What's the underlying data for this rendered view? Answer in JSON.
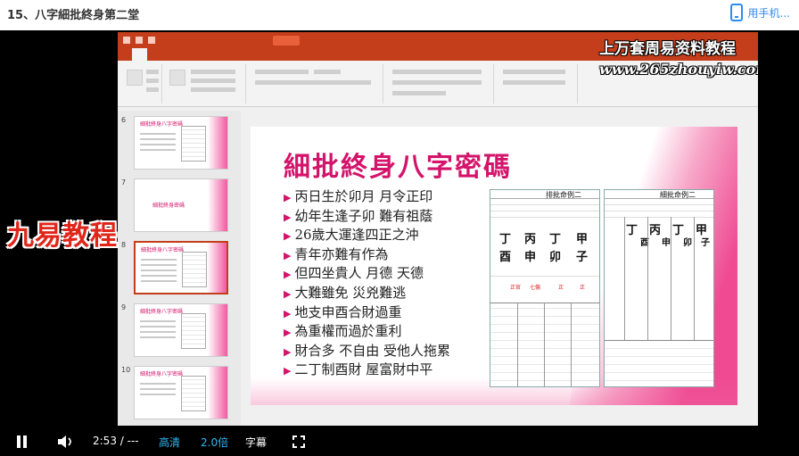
{
  "page": {
    "title": "15、八字細批終身第二堂"
  },
  "header": {
    "phone_label": "用手机..."
  },
  "watermark": {
    "line1": "上万套周易资料教程",
    "line2": "www.265zhouyiw.com"
  },
  "overlay_logo": "九易教程",
  "thumbnails": [
    {
      "num": "6",
      "title": "細批終身八字密碼"
    },
    {
      "num": "7",
      "title": "細批終身密碼"
    },
    {
      "num": "8",
      "title": "細批終身八字密碼"
    },
    {
      "num": "9",
      "title": "細批終身八字密碼"
    },
    {
      "num": "10",
      "title": "細批終身八字密碼"
    }
  ],
  "slide": {
    "title": "細批終身八字密碼",
    "bullets": [
      "丙日生於卯月 月令正印",
      "幼年生逢子卯 難有祖蔭",
      "26歲大運逢四正之沖",
      "青年亦難有作為",
      "但四坐貴人 月德 天德",
      "大難雖免 災兇難逃",
      "地支申酉合財過重",
      "為重權而過於重利",
      "財合多 不自由 受他人拖累",
      "二丁制酉財 屋富財中平"
    ],
    "chart1": {
      "title": "排批命例二",
      "pillars_top": [
        "丁",
        "丙",
        "丁",
        "甲"
      ],
      "pillars_bottom": [
        "酉",
        "申",
        "卯",
        "子"
      ],
      "notes": [
        "正官",
        "七傷",
        "正",
        "正"
      ]
    },
    "chart2": {
      "title": "細批命例二",
      "pillars_top": [
        "丁",
        "丙",
        "丁",
        "甲"
      ],
      "pillars_bottom": [
        "酉",
        "申",
        "卯",
        "子"
      ]
    }
  },
  "controls": {
    "time": "2:53 / ---",
    "quality": "高清",
    "speed": "2.0倍",
    "subtitle": "字幕"
  },
  "colors": {
    "accent": "#d4146b",
    "ribbon": "#c43e1c",
    "link": "#2d8cf0"
  }
}
